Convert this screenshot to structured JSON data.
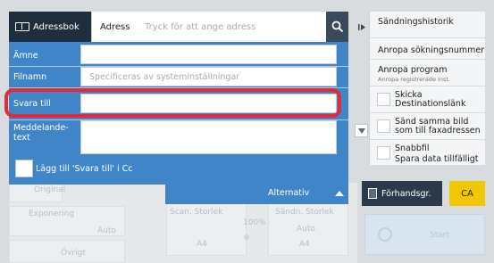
{
  "header": {
    "address_book_label": "Adressbok",
    "address_label": "Adress",
    "address_placeholder": "Tryck för att ange adress",
    "search_icon": "search-icon"
  },
  "form": {
    "subject_label": "Ämne",
    "filename_label": "Filnamn",
    "filename_placeholder": "Specificeras av systeminställningar",
    "reply_to_label": "Svara till",
    "message_label": "Meddelande-\ntext",
    "cc_label": "Lägg till 'Svara till' i Cc",
    "alternatives_label": "Alternativ"
  },
  "background": {
    "original_label": "Original",
    "exposure_label": "Exponering",
    "exposure_value": "Auto",
    "other_label": "Övrigt",
    "scan_size_label": "Scan. Storlek",
    "scan_size_value": "A4",
    "send_size_label": "Sändn. Storlek",
    "send_size_value_auto": "Auto",
    "send_size_value": "A4",
    "zoom_value": "100%",
    "start_label": "Start"
  },
  "sidebar": {
    "history_label": "Sändningshistorik",
    "recall_search_label": "Anropa sökningsnummer",
    "recall_program_label": "Anropa program",
    "recall_program_sub": "Anropa registrerade inst.",
    "send_link_label": "Skicka Destinationslänk",
    "same_image_fax_label": "Sänd samma bild som till faxadressen",
    "quick_file_label": "Snabbfil",
    "quick_file_sub": "Spara data tillfälligt"
  },
  "actions": {
    "preview_label": "Förhandsgr.",
    "ca_label": "CA"
  },
  "colors": {
    "form_blue": "#3f85c8",
    "topbar_dark": "#3a4a5b",
    "highlight_red": "#e12a3b",
    "ca_yellow": "#f1c700"
  }
}
